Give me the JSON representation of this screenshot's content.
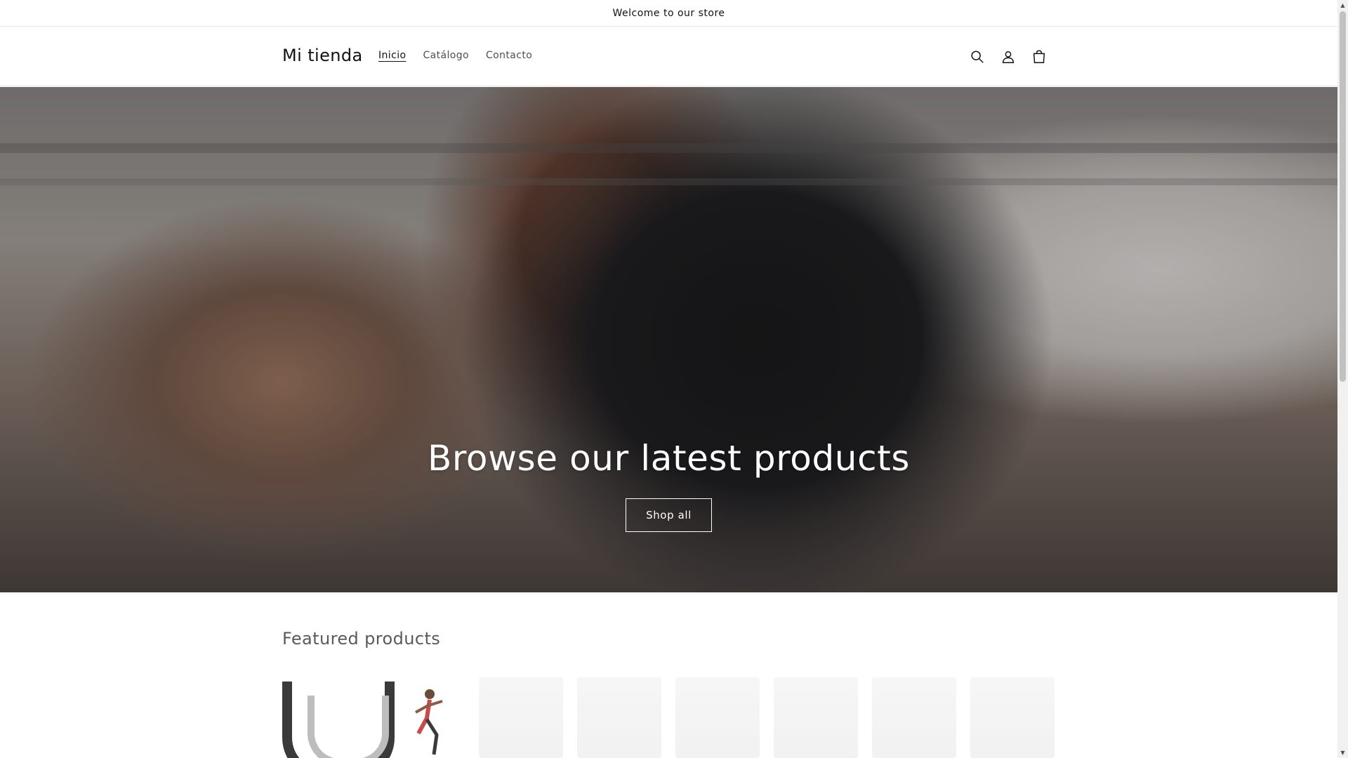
{
  "announcement": {
    "text": "Welcome to our store"
  },
  "header": {
    "logo": "Mi tienda",
    "nav": [
      {
        "label": "Inicio",
        "active": true
      },
      {
        "label": "Catálogo",
        "active": false
      },
      {
        "label": "Contacto",
        "active": false
      }
    ],
    "icons": [
      "search-icon",
      "account-icon",
      "cart-icon"
    ]
  },
  "hero": {
    "title": "Browse our latest products",
    "button_label": "Shop all"
  },
  "featured": {
    "title": "Featured products"
  },
  "colors": {
    "text": "#121212",
    "background": "#ffffff",
    "border": "#e6e6e6",
    "hero_button_border": "#ffffff"
  }
}
